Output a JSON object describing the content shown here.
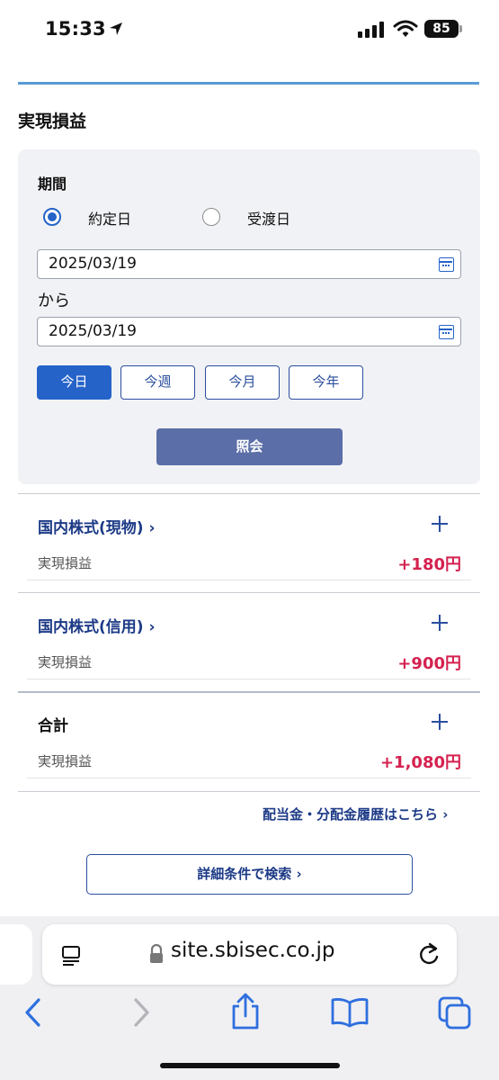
{
  "status_bar": {
    "time": "15:33",
    "battery": "85"
  },
  "page": {
    "title": "実現損益",
    "filter": {
      "period_label": "期間",
      "radio_options": [
        {
          "label": "約定日",
          "selected": true
        },
        {
          "label": "受渡日",
          "selected": false
        }
      ],
      "date_from": "2025/03/19",
      "kara": "から",
      "date_to": "2025/03/19",
      "range_buttons": [
        "今日",
        "今週",
        "今月",
        "今年"
      ],
      "active_range": "今日",
      "query_label": "照会"
    },
    "accounts": [
      {
        "title": "国内株式(現物)",
        "chevron": "›",
        "label": "実現損益",
        "value": "+180円"
      },
      {
        "title": "国内株式(信用)",
        "chevron": "›",
        "label": "実現損益",
        "value": "+900円"
      }
    ],
    "total": {
      "title": "合計",
      "label": "実現損益",
      "value": "+1,080円"
    },
    "dividend_link": "配当金・分配金履歴はこちら ›",
    "detail_search": "詳細条件で検索 ›"
  },
  "browser": {
    "url": "site.sbisec.co.jp"
  },
  "colors": {
    "accent": "#2563c9",
    "query_button": "#5c6ea8",
    "positive_value": "#d4224f",
    "link": "#1c3a86"
  },
  "icons": [
    "location-arrow-icon",
    "signal-icon",
    "wifi-icon",
    "battery-icon",
    "calendar-icon",
    "plus-icon",
    "reader-icon",
    "lock-icon",
    "reload-icon",
    "back-icon",
    "forward-icon",
    "share-icon",
    "bookmarks-icon",
    "tabs-icon"
  ]
}
